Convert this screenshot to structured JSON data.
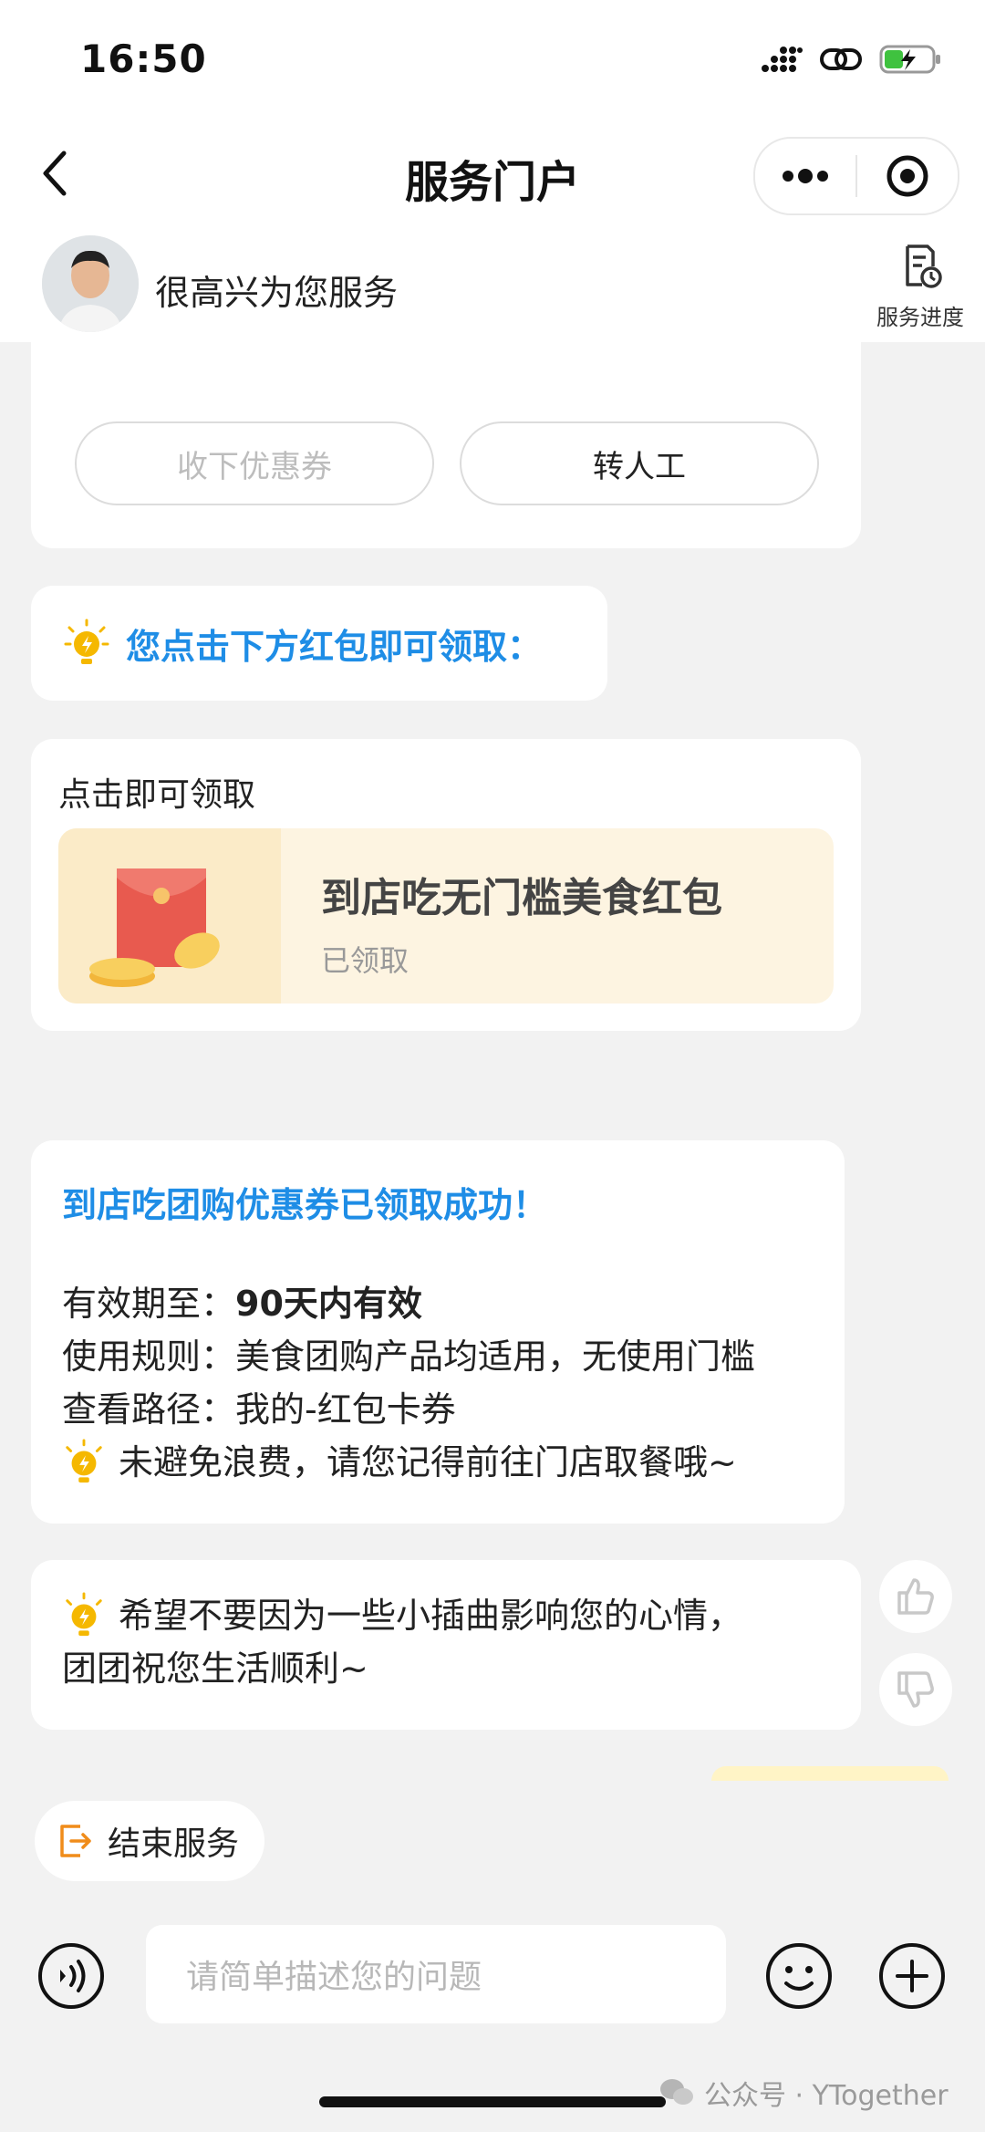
{
  "status_bar": {
    "time": "16:50"
  },
  "nav": {
    "title": "服务门户",
    "more_icon": "more-dots-icon",
    "target_icon": "target-icon"
  },
  "agent": {
    "greeting": "很高兴为您服务",
    "progress_label": "服务进度"
  },
  "partial_line": "",
  "choice_buttons": {
    "accept_label": "收下优惠券",
    "human_label": "转人工"
  },
  "tip1": {
    "text": "您点击下方红包即可领取："
  },
  "redpacket_card": {
    "heading": "点击即可领取",
    "title": "到店吃无门槛美食红包",
    "status": "已领取"
  },
  "success_card": {
    "title": "到店吃团购优惠券已领取成功！",
    "validity_label": "有效期至：",
    "validity_value": "90天内有效",
    "rule_label": "使用规则：",
    "rule_value": "美食团购产品均适用，无使用门槛",
    "path_label": "查看路径：",
    "path_value": "我的-红包卡券",
    "tip": "未避免浪费，请您记得前往门店取餐哦~"
  },
  "wish_card": {
    "line1": "希望不要因为一些小插曲影响您的心情，",
    "line2": "团团祝您生活顺利~"
  },
  "bottom": {
    "end_label": "结束服务",
    "input_placeholder": "请简单描述您的问题"
  },
  "watermark": {
    "text": "公众号 · YTogether"
  },
  "colors": {
    "accent_blue": "#1e8de6",
    "tip_yellow": "#f5b800",
    "end_orange": "#f08c1a"
  }
}
